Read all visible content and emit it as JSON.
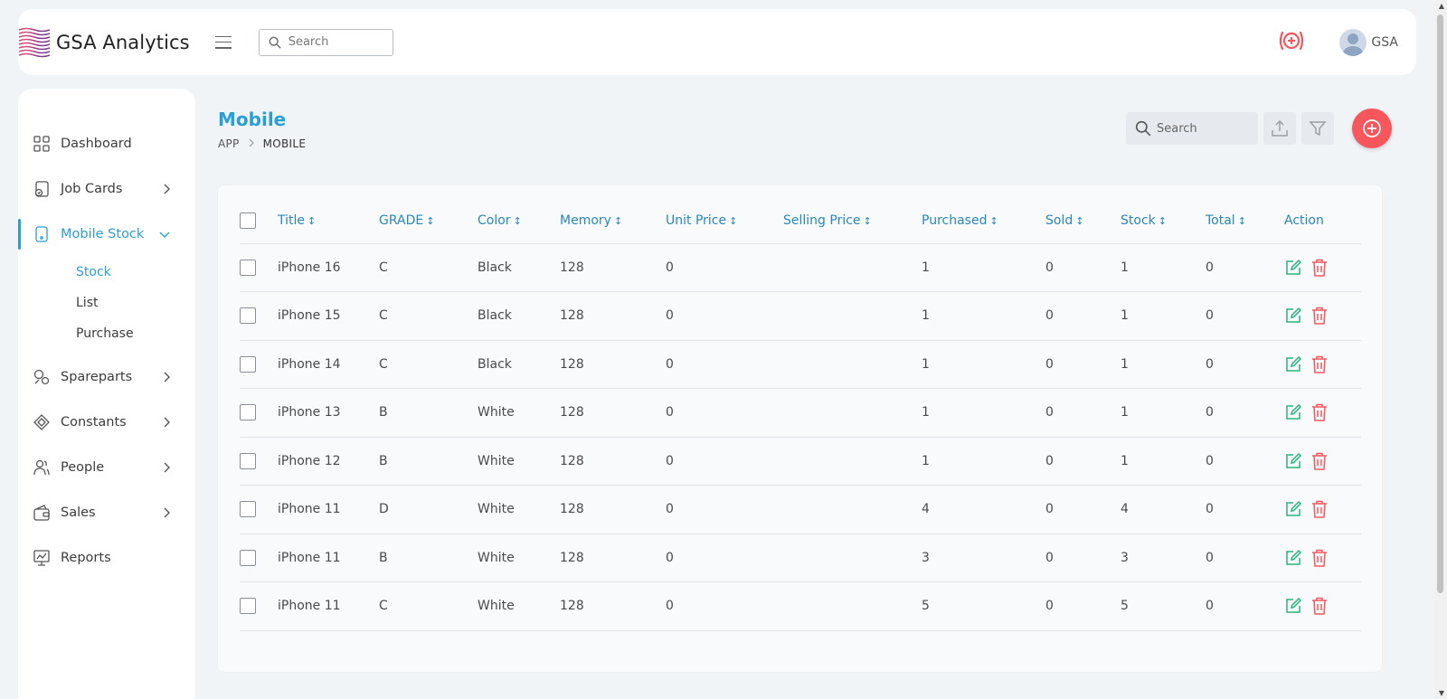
{
  "app": {
    "title": "GSA Analytics",
    "user": "GSA"
  },
  "top_search": {
    "placeholder": "Search"
  },
  "sidebar": {
    "items": [
      {
        "label": "Dashboard"
      },
      {
        "label": "Job Cards"
      },
      {
        "label": "Mobile Stock"
      },
      {
        "label": "Spareparts"
      },
      {
        "label": "Constants"
      },
      {
        "label": "People"
      },
      {
        "label": "Sales"
      },
      {
        "label": "Reports"
      }
    ],
    "sub_items": [
      {
        "label": "Stock"
      },
      {
        "label": "List"
      },
      {
        "label": "Purchase"
      }
    ]
  },
  "page": {
    "title": "Mobile",
    "breadcrumb": [
      "APP",
      "MOBILE"
    ],
    "search_placeholder": "Search"
  },
  "table": {
    "columns": [
      "Title",
      "GRADE",
      "Color",
      "Memory",
      "Unit Price",
      "Selling Price",
      "Purchased",
      "Sold",
      "Stock",
      "Total",
      "Action"
    ],
    "sort_glyph": "↕",
    "rows": [
      {
        "title": "iPhone 16",
        "grade": "C",
        "color": "Black",
        "memory": "128",
        "unit_price": "0",
        "selling_price": "",
        "purchased": "1",
        "sold": "0",
        "stock": "1",
        "total": "0"
      },
      {
        "title": "iPhone 15",
        "grade": "C",
        "color": "Black",
        "memory": "128",
        "unit_price": "0",
        "selling_price": "",
        "purchased": "1",
        "sold": "0",
        "stock": "1",
        "total": "0"
      },
      {
        "title": "iPhone 14",
        "grade": "C",
        "color": "Black",
        "memory": "128",
        "unit_price": "0",
        "selling_price": "",
        "purchased": "1",
        "sold": "0",
        "stock": "1",
        "total": "0"
      },
      {
        "title": "iPhone 13",
        "grade": "B",
        "color": "White",
        "memory": "128",
        "unit_price": "0",
        "selling_price": "",
        "purchased": "1",
        "sold": "0",
        "stock": "1",
        "total": "0"
      },
      {
        "title": "iPhone 12",
        "grade": "B",
        "color": "White",
        "memory": "128",
        "unit_price": "0",
        "selling_price": "",
        "purchased": "1",
        "sold": "0",
        "stock": "1",
        "total": "0"
      },
      {
        "title": "iPhone 11",
        "grade": "D",
        "color": "White",
        "memory": "128",
        "unit_price": "0",
        "selling_price": "",
        "purchased": "4",
        "sold": "0",
        "stock": "4",
        "total": "0"
      },
      {
        "title": "iPhone 11",
        "grade": "B",
        "color": "White",
        "memory": "128",
        "unit_price": "0",
        "selling_price": "",
        "purchased": "3",
        "sold": "0",
        "stock": "3",
        "total": "0"
      },
      {
        "title": "iPhone 11",
        "grade": "C",
        "color": "White",
        "memory": "128",
        "unit_price": "0",
        "selling_price": "",
        "purchased": "5",
        "sold": "0",
        "stock": "5",
        "total": "0"
      }
    ]
  },
  "colors": {
    "accent": "#2a9fd6",
    "header_text": "#2a87b8",
    "danger": "#f7565d",
    "edit": "#28b47a"
  },
  "icons": {
    "logo": "wave-stripes-logo",
    "alert": "add-circle-signal-icon",
    "upload": "upload-icon",
    "filter": "filter-icon",
    "edit": "edit-icon",
    "delete": "trash-icon"
  }
}
